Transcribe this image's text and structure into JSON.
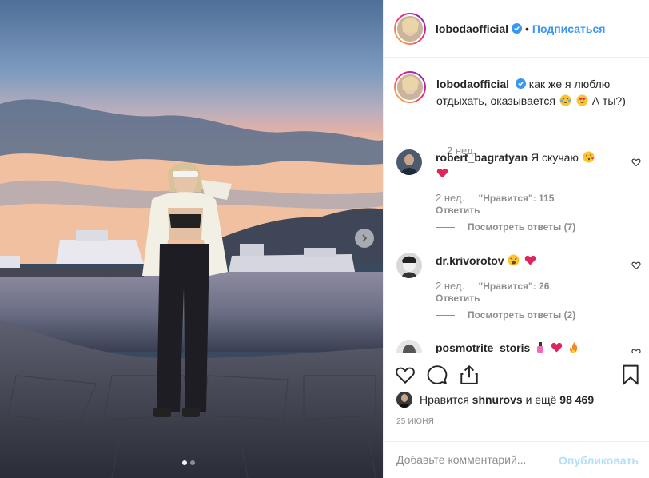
{
  "post": {
    "carousel": {
      "slide_count": 2,
      "active_slide": 1
    }
  },
  "header": {
    "username": "lobodaofficial",
    "separator": "•",
    "follow_label": "Подписаться"
  },
  "caption": {
    "username": "lobodaofficial",
    "text_part1": "как же я люблю отдыхать, оказывается",
    "text_part2": "А ты?)",
    "emojis": [
      "tears-of-joy-emoji",
      "heart-eyes-emoji"
    ],
    "time": "2 нед."
  },
  "comments": [
    {
      "username": "robert_bagratyan",
      "text": "Я скучаю",
      "emojis": [
        "kiss-emoji",
        "red-heart-emoji"
      ],
      "time": "2 нед.",
      "likes": "\"Нравится\": 115",
      "reply_label": "Ответить",
      "view_replies": "Посмотреть ответы (7)"
    },
    {
      "username": "dr.krivorotov",
      "text": "",
      "emojis": [
        "weary-emoji",
        "red-heart-emoji"
      ],
      "time": "2 нед.",
      "likes": "\"Нравится\": 26",
      "reply_label": "Ответить",
      "view_replies": "Посмотреть ответы (2)"
    },
    {
      "username": "posmotrite_storis",
      "text": "",
      "emojis": [
        "nail-polish-emoji",
        "red-heart-emoji",
        "fire-emoji"
      ]
    }
  ],
  "actions": {
    "liked_by_prefix": "Нравится",
    "liked_by_user": "shnurovs",
    "liked_by_suffix_prefix": "и ещё",
    "liked_by_count": "98 469",
    "date": "25 ИЮНЯ"
  },
  "add_comment": {
    "placeholder": "Добавьте комментарий...",
    "publish_label": "Опубликовать"
  },
  "colors": {
    "accent_blue": "#3897f0",
    "publish_disabled": "#b2dffc",
    "secondary_text": "#8e8e8e",
    "border": "#efefef"
  }
}
